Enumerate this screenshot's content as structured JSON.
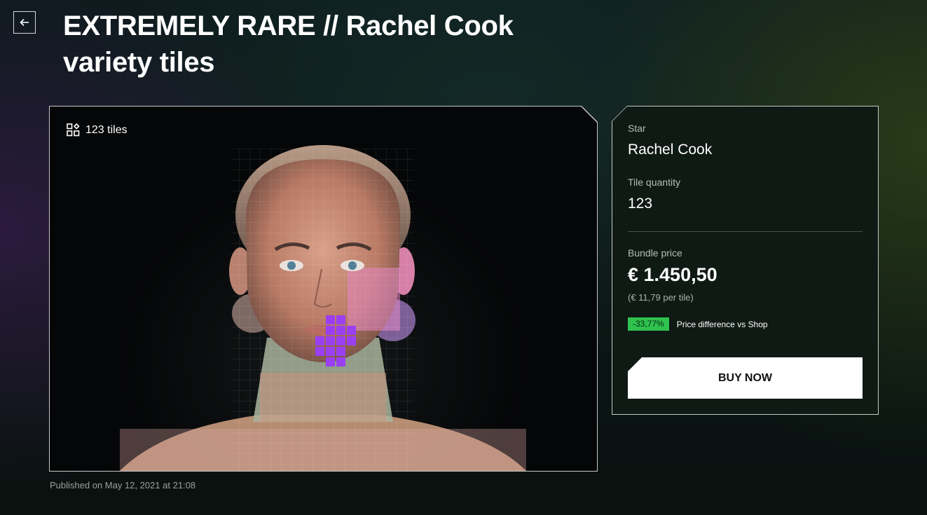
{
  "header": {
    "back_icon": "arrow-left-icon",
    "title": "EXTREMELY RARE // Rachel Cook variety tiles"
  },
  "media": {
    "tiles_icon": "tiles-grid-icon",
    "tiles_count": "123 tiles",
    "published": "Published on May 12, 2021 at 21:08"
  },
  "info": {
    "star_label": "Star",
    "star_value": "Rachel Cook",
    "quantity_label": "Tile quantity",
    "quantity_value": "123",
    "bundle_label": "Bundle price",
    "bundle_price": "€ 1.450,50",
    "per_tile": "(€ 11,79 per tile)",
    "diff_badge": "-33,77%",
    "diff_label": "Price difference vs Shop",
    "buy_label": "BUY NOW"
  },
  "colors": {
    "accent_green": "#2fc24f",
    "highlight_tiles": "#9b3ff2"
  }
}
